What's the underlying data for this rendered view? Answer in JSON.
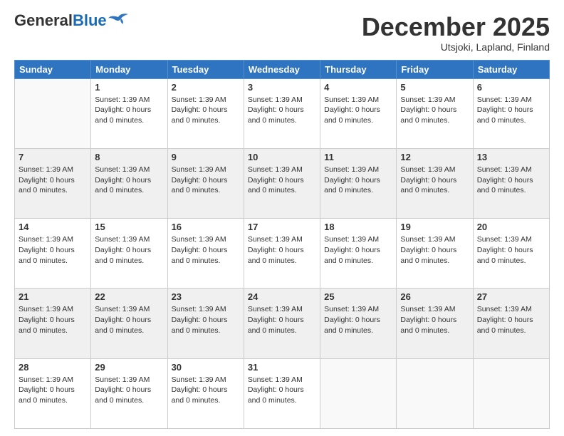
{
  "header": {
    "logo": {
      "general": "General",
      "blue": "Blue"
    },
    "title": "December 2025",
    "location": "Utsjoki, Lapland, Finland"
  },
  "calendar": {
    "days_of_week": [
      "Sunday",
      "Monday",
      "Tuesday",
      "Wednesday",
      "Thursday",
      "Friday",
      "Saturday"
    ],
    "day_info_text": "Sunset: 1:39 AM\nDaylight: 0 hours and 0 minutes.",
    "weeks": [
      {
        "shade": false,
        "days": [
          {
            "number": "",
            "empty": true
          },
          {
            "number": "1",
            "info": "Sunset: 1:39 AM\nDaylight: 0 hours\nand 0 minutes."
          },
          {
            "number": "2",
            "info": "Sunset: 1:39 AM\nDaylight: 0 hours\nand 0 minutes."
          },
          {
            "number": "3",
            "info": "Sunset: 1:39 AM\nDaylight: 0 hours\nand 0 minutes."
          },
          {
            "number": "4",
            "info": "Sunset: 1:39 AM\nDaylight: 0 hours\nand 0 minutes."
          },
          {
            "number": "5",
            "info": "Sunset: 1:39 AM\nDaylight: 0 hours\nand 0 minutes."
          },
          {
            "number": "6",
            "info": "Sunset: 1:39 AM\nDaylight: 0 hours\nand 0 minutes."
          }
        ]
      },
      {
        "shade": true,
        "days": [
          {
            "number": "7",
            "info": "Sunset: 1:39 AM\nDaylight: 0 hours\nand 0 minutes."
          },
          {
            "number": "8",
            "info": "Sunset: 1:39 AM\nDaylight: 0 hours\nand 0 minutes."
          },
          {
            "number": "9",
            "info": "Sunset: 1:39 AM\nDaylight: 0 hours\nand 0 minutes."
          },
          {
            "number": "10",
            "info": "Sunset: 1:39 AM\nDaylight: 0 hours\nand 0 minutes."
          },
          {
            "number": "11",
            "info": "Sunset: 1:39 AM\nDaylight: 0 hours\nand 0 minutes."
          },
          {
            "number": "12",
            "info": "Sunset: 1:39 AM\nDaylight: 0 hours\nand 0 minutes."
          },
          {
            "number": "13",
            "info": "Sunset: 1:39 AM\nDaylight: 0 hours\nand 0 minutes."
          }
        ]
      },
      {
        "shade": false,
        "days": [
          {
            "number": "14",
            "info": "Sunset: 1:39 AM\nDaylight: 0 hours\nand 0 minutes."
          },
          {
            "number": "15",
            "info": "Sunset: 1:39 AM\nDaylight: 0 hours\nand 0 minutes."
          },
          {
            "number": "16",
            "info": "Sunset: 1:39 AM\nDaylight: 0 hours\nand 0 minutes."
          },
          {
            "number": "17",
            "info": "Sunset: 1:39 AM\nDaylight: 0 hours\nand 0 minutes."
          },
          {
            "number": "18",
            "info": "Sunset: 1:39 AM\nDaylight: 0 hours\nand 0 minutes."
          },
          {
            "number": "19",
            "info": "Sunset: 1:39 AM\nDaylight: 0 hours\nand 0 minutes."
          },
          {
            "number": "20",
            "info": "Sunset: 1:39 AM\nDaylight: 0 hours\nand 0 minutes."
          }
        ]
      },
      {
        "shade": true,
        "days": [
          {
            "number": "21",
            "info": "Sunset: 1:39 AM\nDaylight: 0 hours\nand 0 minutes."
          },
          {
            "number": "22",
            "info": "Sunset: 1:39 AM\nDaylight: 0 hours\nand 0 minutes."
          },
          {
            "number": "23",
            "info": "Sunset: 1:39 AM\nDaylight: 0 hours\nand 0 minutes."
          },
          {
            "number": "24",
            "info": "Sunset: 1:39 AM\nDaylight: 0 hours\nand 0 minutes."
          },
          {
            "number": "25",
            "info": "Sunset: 1:39 AM\nDaylight: 0 hours\nand 0 minutes."
          },
          {
            "number": "26",
            "info": "Sunset: 1:39 AM\nDaylight: 0 hours\nand 0 minutes."
          },
          {
            "number": "27",
            "info": "Sunset: 1:39 AM\nDaylight: 0 hours\nand 0 minutes."
          }
        ]
      },
      {
        "shade": false,
        "days": [
          {
            "number": "28",
            "info": "Sunset: 1:39 AM\nDaylight: 0 hours\nand 0 minutes."
          },
          {
            "number": "29",
            "info": "Sunset: 1:39 AM\nDaylight: 0 hours\nand 0 minutes."
          },
          {
            "number": "30",
            "info": "Sunset: 1:39 AM\nDaylight: 0 hours\nand 0 minutes."
          },
          {
            "number": "31",
            "info": "Sunset: 1:39 AM\nDaylight: 0 hours\nand 0 minutes."
          },
          {
            "number": "",
            "empty": true
          },
          {
            "number": "",
            "empty": true
          },
          {
            "number": "",
            "empty": true
          }
        ]
      }
    ]
  }
}
